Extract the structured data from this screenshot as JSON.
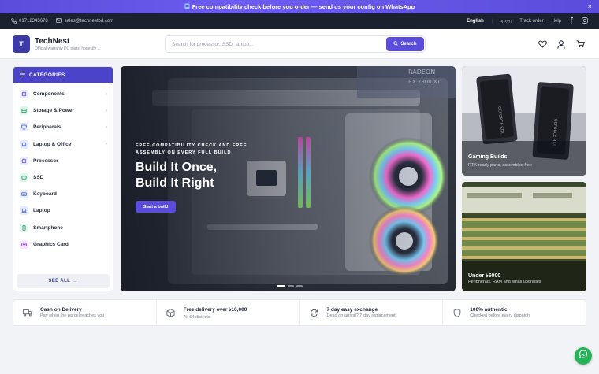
{
  "announcement": {
    "icon": "bolt-icon",
    "text": "Free compatibility check before you order — send us your config on WhatsApp",
    "close": "×"
  },
  "utility": {
    "phone": "01712345678",
    "email": "sales@technestbd.com",
    "lang_en": "English",
    "lang_bn": "বাংলা",
    "track": "Track order",
    "help": "Help"
  },
  "header": {
    "logo_letter": "T",
    "brand": "TechNest",
    "tagline": "Official warranty PC parts, honestly ...",
    "search_placeholder": "Search for processor, SSD, laptop...",
    "search_button": "Search"
  },
  "sidebar": {
    "title": "CATEGORIES",
    "items": [
      {
        "label": "Components",
        "icon": "cpu-icon",
        "color": "#6a5ee8",
        "bg": "#ecebfd",
        "chevron": true
      },
      {
        "label": "Storage & Power",
        "icon": "storage-icon",
        "color": "#1aa36b",
        "bg": "#e3f6ee",
        "chevron": true
      },
      {
        "label": "Peripherals",
        "icon": "monitor-icon",
        "color": "#4c6fe0",
        "bg": "#e6ecfc",
        "chevron": true
      },
      {
        "label": "Laptop & Office",
        "icon": "laptop-icon",
        "color": "#4c6fe0",
        "bg": "#e6ecfc",
        "chevron": true
      },
      {
        "label": "Processor",
        "icon": "processor-icon",
        "color": "#6a5ee8",
        "bg": "#ecebfd",
        "chevron": false
      },
      {
        "label": "SSD",
        "icon": "ssd-icon",
        "color": "#1aa36b",
        "bg": "#e3f6ee",
        "chevron": false
      },
      {
        "label": "Keyboard",
        "icon": "keyboard-icon",
        "color": "#4c6fe0",
        "bg": "#e6ecfc",
        "chevron": false
      },
      {
        "label": "Laptop",
        "icon": "laptop-icon",
        "color": "#4c6fe0",
        "bg": "#e6ecfc",
        "chevron": false
      },
      {
        "label": "Smartphone",
        "icon": "smartphone-icon",
        "color": "#1aa36b",
        "bg": "#e3f6ee",
        "chevron": false
      },
      {
        "label": "Graphics Card",
        "icon": "gpu-icon",
        "color": "#a24fd6",
        "bg": "#f4e8fb",
        "chevron": false
      }
    ],
    "see_all": "SEE ALL"
  },
  "hero": {
    "eyebrow": "FREE COMPATIBILITY CHECK AND FREE ASSEMBLY ON EVERY FULL BUILD",
    "title_line1": "Build It Once,",
    "title_line2": "Build It Right",
    "cta": "Start a build",
    "slide_count": 3,
    "active_slide": 1
  },
  "promos": [
    {
      "title": "Gaming Builds",
      "subtitle": "RTX-ready parts, assembled free"
    },
    {
      "title": "Under ৳5000",
      "subtitle": "Peripherals, RAM and small upgrades"
    }
  ],
  "features": [
    {
      "icon": "truck-icon",
      "title": "Cash on Delivery",
      "subtitle": "Pay when the parcel reaches you"
    },
    {
      "icon": "box-icon",
      "title": "Free delivery over ৳10,000",
      "subtitle": "All 64 districts"
    },
    {
      "icon": "refresh-icon",
      "title": "7 day easy exchange",
      "subtitle": "Dead on arrival? 7 day replacement"
    },
    {
      "icon": "shield-icon",
      "title": "100% authentic",
      "subtitle": "Checked before every dispatch"
    }
  ],
  "colors": {
    "accent": "#5b4ddb",
    "category_header": "#4b43c9",
    "whatsapp": "#22b455"
  }
}
